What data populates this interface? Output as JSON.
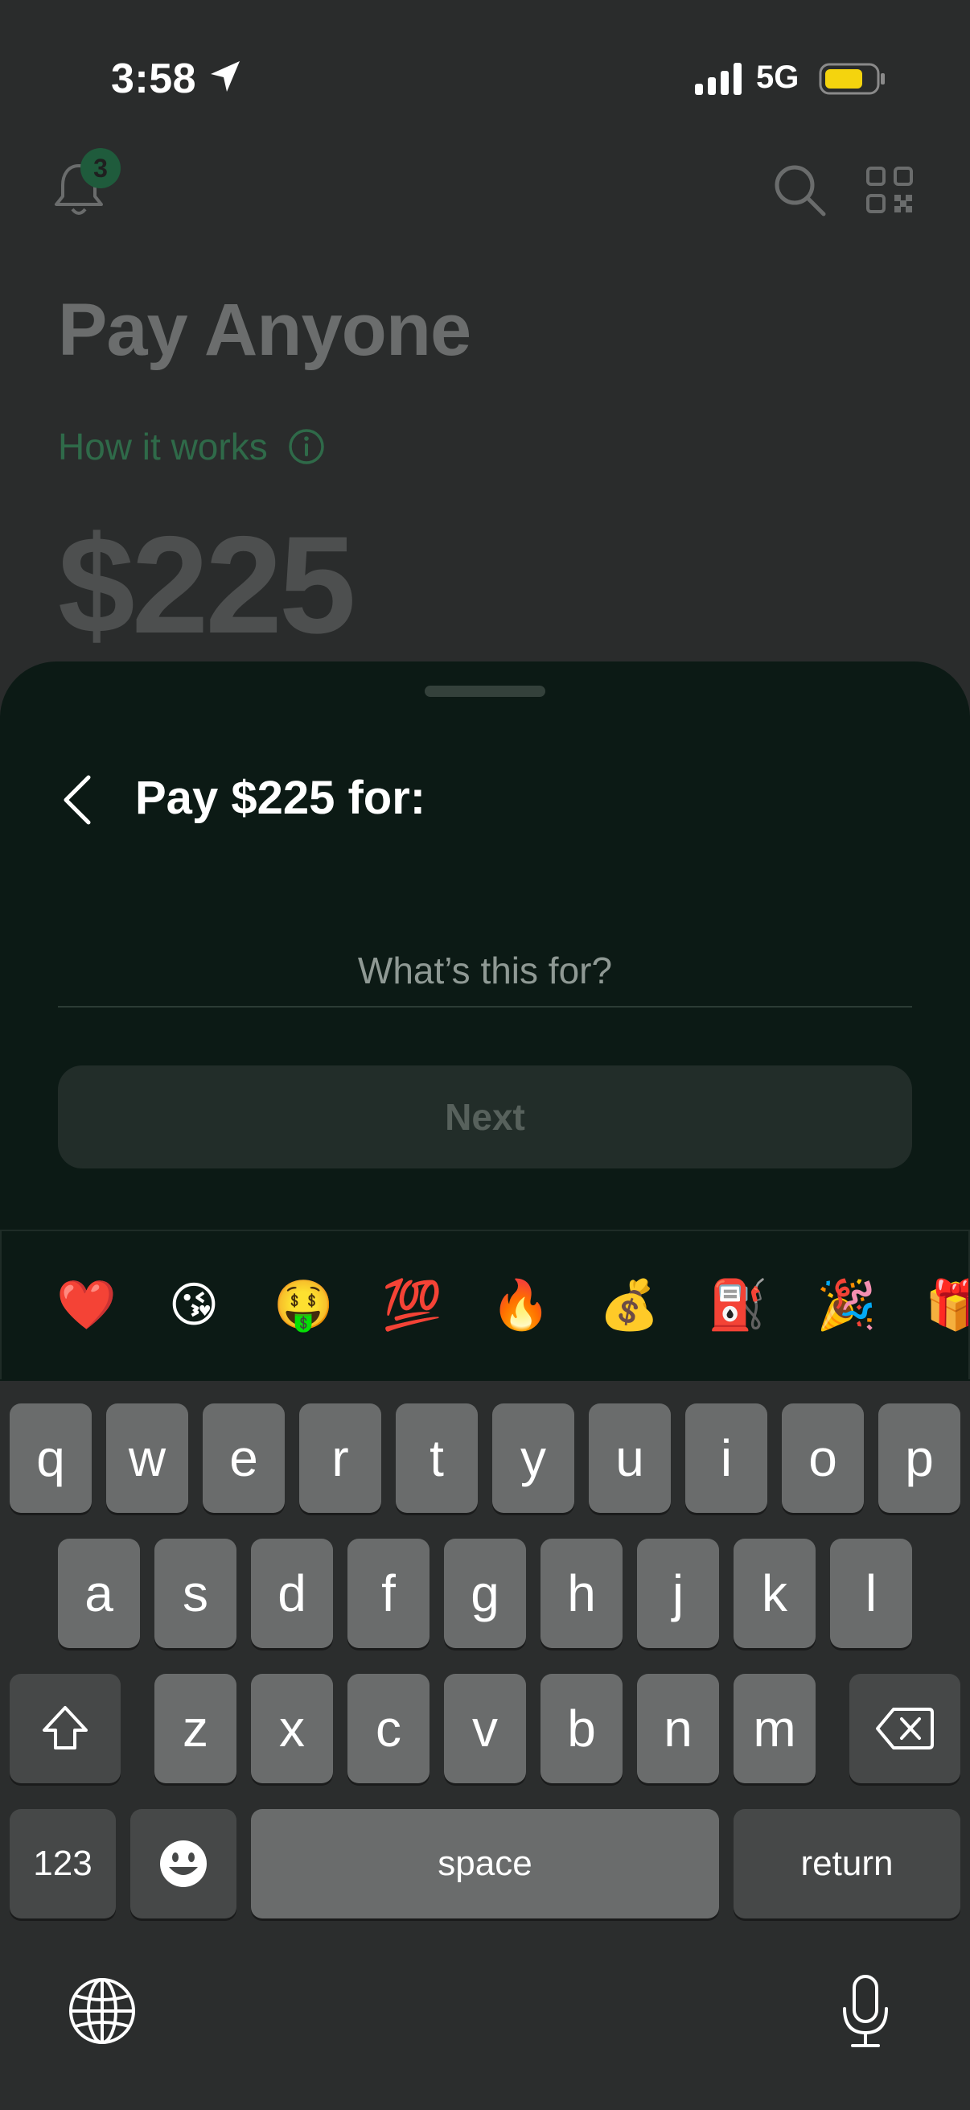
{
  "status_bar": {
    "time": "3:58",
    "network": "5G",
    "battery_color": "#f4d40e"
  },
  "header": {
    "notification_count": "3"
  },
  "background": {
    "title": "Pay Anyone",
    "how_it_works": "How it works",
    "amount": "$225"
  },
  "sheet": {
    "title": "Pay $225 for:",
    "note_placeholder": "What’s this for?",
    "next_label": "Next"
  },
  "emoji_suggestions": [
    "❤️",
    "😘",
    "🤑",
    "💯",
    "🔥",
    "💰",
    "⛽",
    "🎉",
    "🎁"
  ],
  "keyboard": {
    "row1": [
      "q",
      "w",
      "e",
      "r",
      "t",
      "y",
      "u",
      "i",
      "o",
      "p"
    ],
    "row2": [
      "a",
      "s",
      "d",
      "f",
      "g",
      "h",
      "j",
      "k",
      "l"
    ],
    "row3": [
      "z",
      "x",
      "c",
      "v",
      "b",
      "n",
      "m"
    ],
    "numbers_label": "123",
    "space_label": "space",
    "return_label": "return"
  },
  "colors": {
    "accent_green": "#2f6a49",
    "sheet_bg": "#0c1a15"
  }
}
